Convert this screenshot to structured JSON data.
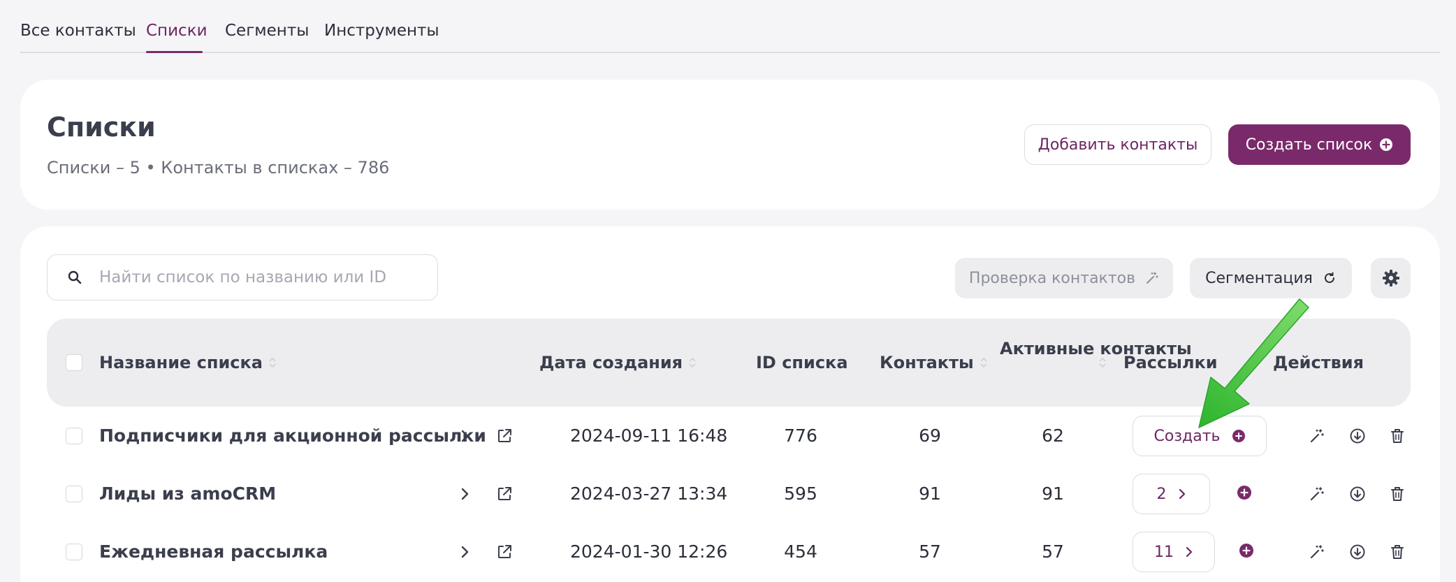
{
  "tabs": [
    {
      "label": "Все контакты"
    },
    {
      "label": "Списки"
    },
    {
      "label": "Сегменты"
    },
    {
      "label": "Инструменты"
    }
  ],
  "active_tab": "Списки",
  "header": {
    "title": "Списки",
    "subtitle": "Списки – 5 • Контакты в списках – 786",
    "add_contacts_label": "Добавить контакты",
    "create_list_label": "Создать список"
  },
  "toolbar": {
    "search_placeholder": "Найти список по названию или ID",
    "check_contacts_label": "Проверка контактов",
    "segmentation_label": "Сегментация"
  },
  "table": {
    "columns": {
      "name": "Название списка",
      "created": "Дата создания",
      "id": "ID списка",
      "contacts": "Контакты",
      "active_line1": "Активные",
      "active_line2": "контакты",
      "mailings": "Рассылки",
      "actions": "Действия"
    },
    "rows": [
      {
        "name": "Подписчики для акционной рассылки",
        "created": "2024-09-11 16:48",
        "id": "776",
        "contacts": "69",
        "active": "62",
        "mailings": "Создать"
      },
      {
        "name": "Лиды из amoCRM",
        "created": "2024-03-27 13:34",
        "id": "595",
        "contacts": "91",
        "active": "91",
        "mailings": "2"
      },
      {
        "name": "Ежедневная рассылка",
        "created": "2024-01-30 12:26",
        "id": "454",
        "contacts": "57",
        "active": "57",
        "mailings": "11"
      }
    ]
  },
  "colors": {
    "accent": "#7a2a6b",
    "annotation_arrow": "#3cc13b"
  }
}
